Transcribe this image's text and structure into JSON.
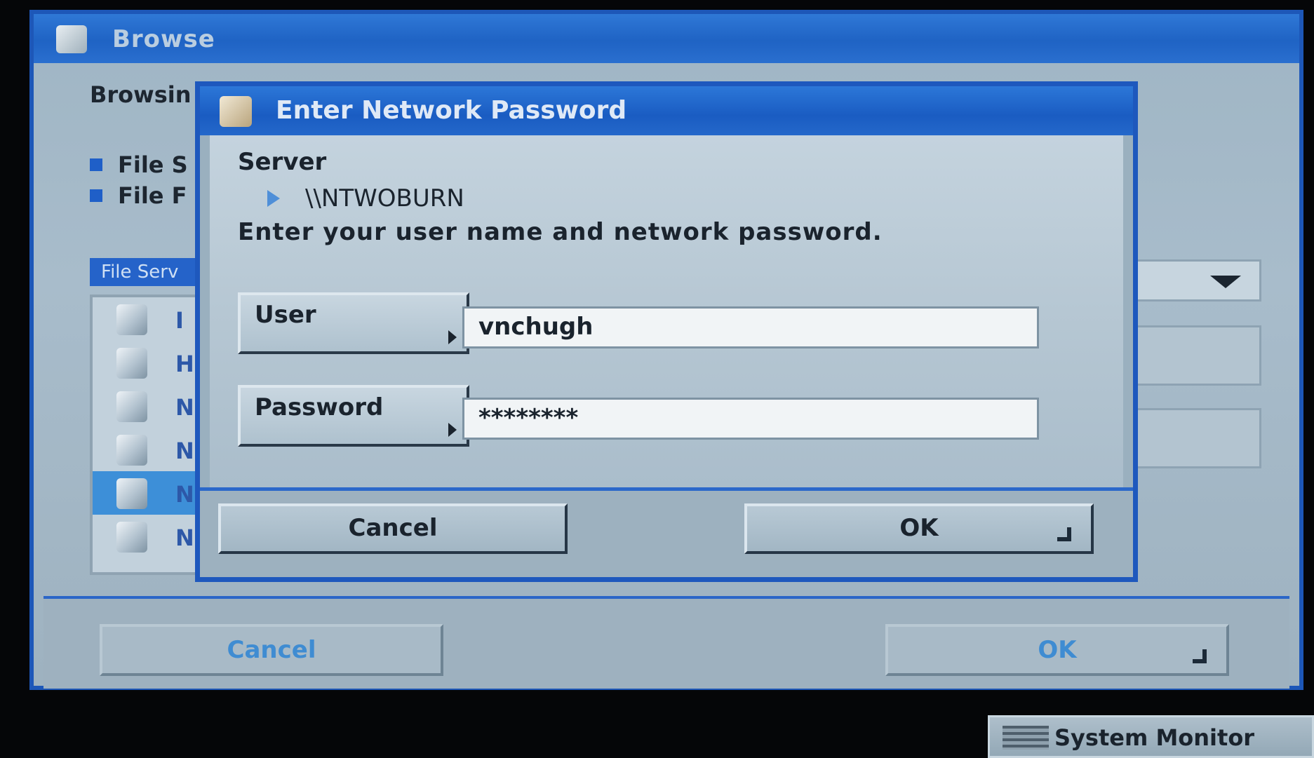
{
  "browse_window": {
    "title": "Browse",
    "browsing_label": "Browsin",
    "options": [
      "File S",
      "File F"
    ],
    "list_header": "File Serv",
    "list_items": [
      "I",
      "H",
      "N",
      "N",
      "N",
      "N"
    ],
    "selected_index": 4,
    "cancel_label": "Cancel",
    "ok_label": "OK"
  },
  "dialog": {
    "title": "Enter Network Password",
    "server_label": "Server",
    "server_name": "\\\\NTWOBURN",
    "instruction": "Enter your user name and network password.",
    "user_label": "User",
    "user_value": "vnchugh",
    "password_label": "Password",
    "password_value": "********",
    "cancel_label": "Cancel",
    "ok_label": "OK"
  },
  "taskbar": {
    "system_monitor_label": "System Monitor"
  },
  "colors": {
    "title_bar": "#1f63c4",
    "selection": "#3d8fd8",
    "window_body": "#a8bccb"
  }
}
